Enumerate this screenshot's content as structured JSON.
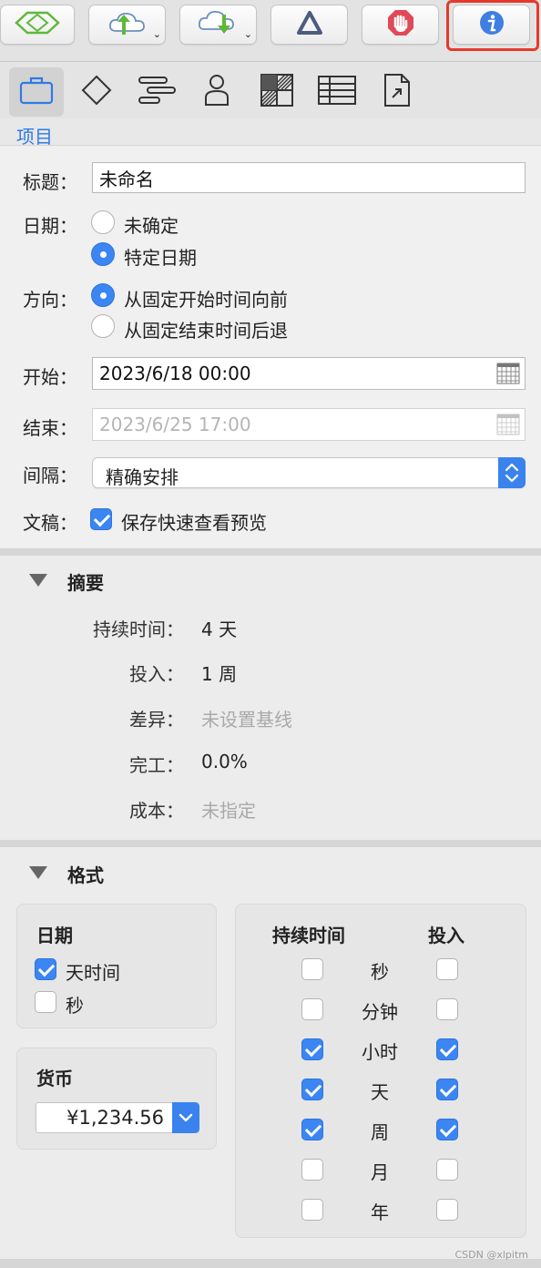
{
  "toolbar": {
    "buttons": [
      {
        "icon": "level-diamond-icon"
      },
      {
        "icon": "cloud-upload-icon"
      },
      {
        "icon": "cloud-download-icon"
      },
      {
        "icon": "delta-triangle-icon"
      },
      {
        "icon": "stop-hand-icon"
      },
      {
        "icon": "info-icon"
      }
    ]
  },
  "tabs": [
    {
      "icon": "briefcase-icon"
    },
    {
      "icon": "diamond-icon"
    },
    {
      "icon": "gantt-bars-icon"
    },
    {
      "icon": "person-icon"
    },
    {
      "icon": "style-grid-icon"
    },
    {
      "icon": "table-icon"
    },
    {
      "icon": "document-export-icon"
    }
  ],
  "section": {
    "title": "项目"
  },
  "project": {
    "title_label": "标题：",
    "title_value": "未命名",
    "date_label": "日期：",
    "date_options": [
      "未确定",
      "特定日期"
    ],
    "date_selected": 1,
    "direction_label": "方向：",
    "direction_options": [
      "从固定开始时间向前",
      "从固定结束时间后退"
    ],
    "direction_selected": 0,
    "start_label": "开始：",
    "start_value": "2023/6/18 00:00",
    "end_label": "结束：",
    "end_value": "2023/6/25 17:00",
    "interval_label": "间隔：",
    "interval_value": "精确安排",
    "doc_label": "文稿：",
    "doc_option": "保存快速查看预览",
    "doc_checked": true
  },
  "summary": {
    "title": "摘要",
    "rows": [
      {
        "label": "持续时间：",
        "value": "4 天",
        "muted": false
      },
      {
        "label": "投入：",
        "value": "1 周",
        "muted": false
      },
      {
        "label": "差异：",
        "value": "未设置基线",
        "muted": true
      },
      {
        "label": "完工：",
        "value": "0.0%",
        "muted": false
      },
      {
        "label": "成本：",
        "value": "未指定",
        "muted": true
      }
    ]
  },
  "format": {
    "title": "格式",
    "date_box_title": "日期",
    "date_options": [
      {
        "label": "天时间",
        "checked": true
      },
      {
        "label": "秒",
        "checked": false
      }
    ],
    "currency_title": "货币",
    "currency_value": "¥1,234.56",
    "duration_header": "持续时间",
    "effort_header": "投入",
    "units": [
      {
        "label": "秒",
        "duration": false,
        "effort": false
      },
      {
        "label": "分钟",
        "duration": false,
        "effort": false
      },
      {
        "label": "小时",
        "duration": true,
        "effort": true
      },
      {
        "label": "天",
        "duration": true,
        "effort": true
      },
      {
        "label": "周",
        "duration": true,
        "effort": true
      },
      {
        "label": "月",
        "duration": false,
        "effort": false
      },
      {
        "label": "年",
        "duration": false,
        "effort": false
      }
    ]
  },
  "watermark": "CSDN @xlpitm",
  "colors": {
    "accent": "#3b86f2",
    "highlight": "#e5392b"
  }
}
